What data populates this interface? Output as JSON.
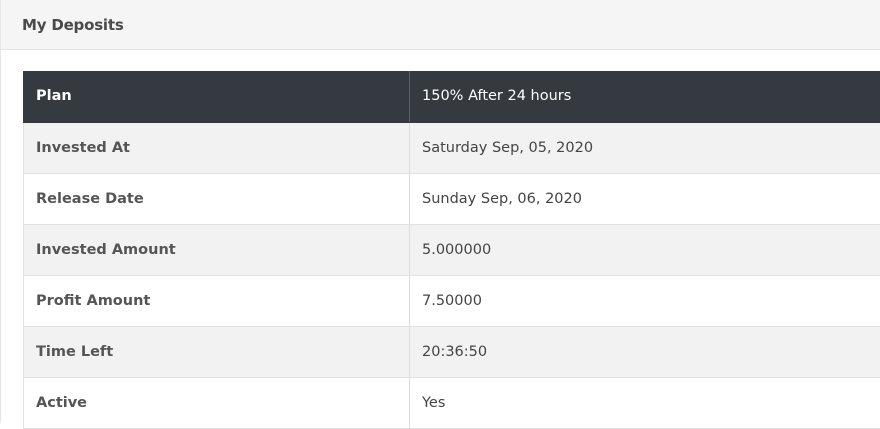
{
  "card": {
    "title": "My Deposits"
  },
  "deposit": {
    "rows": [
      {
        "label": "Plan",
        "value": "150% After 24 hours"
      },
      {
        "label": "Invested At",
        "value": "Saturday Sep, 05, 2020"
      },
      {
        "label": "Release Date",
        "value": "Sunday Sep, 06, 2020"
      },
      {
        "label": "Invested Amount",
        "value": "5.000000"
      },
      {
        "label": "Profit Amount",
        "value": "7.50000"
      },
      {
        "label": "Time Left",
        "value": "20:36:50"
      },
      {
        "label": "Active",
        "value": "Yes"
      }
    ]
  },
  "colors": {
    "header_row_bg": "#343a40",
    "stripe_bg": "#f2f2f2",
    "card_header_bg": "#f5f5f5"
  }
}
